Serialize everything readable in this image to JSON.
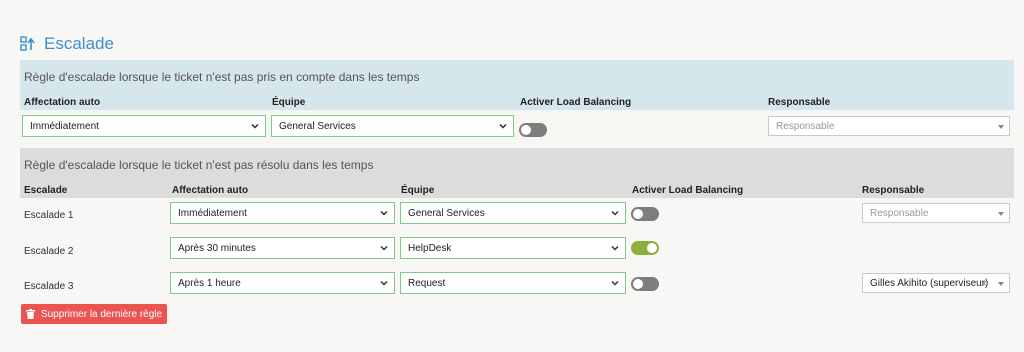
{
  "page": {
    "title": "Escalade"
  },
  "section1": {
    "subtitle": "Règle d'escalade lorsque le ticket n'est pas pris en compte dans les temps",
    "headers": {
      "affectation": "Affectation auto",
      "equipe": "Équipe",
      "load_balancing": "Activer Load Balancing",
      "responsable": "Responsable"
    },
    "row": {
      "affectation": "Immédiatement",
      "equipe": "General Services",
      "load_balancing_on": false,
      "responsable_placeholder": "Responsable"
    }
  },
  "section2": {
    "subtitle": "Règle d'escalade lorsque le ticket n'est pas résolu dans les temps",
    "headers": {
      "escalade": "Escalade",
      "affectation": "Affectation auto",
      "equipe": "Équipe",
      "load_balancing": "Activer Load Balancing",
      "responsable": "Responsable"
    },
    "rows": [
      {
        "label": "Escalade 1",
        "affectation": "Immédiatement",
        "equipe": "General Services",
        "load_balancing_on": false,
        "responsable": "Responsable"
      },
      {
        "label": "Escalade 2",
        "affectation": "Après 30 minutes",
        "equipe": "HelpDesk",
        "load_balancing_on": true,
        "responsable": ""
      },
      {
        "label": "Escalade 3",
        "affectation": "Après 1 heure",
        "equipe": "Request",
        "load_balancing_on": false,
        "responsable": "Gilles Akihito (superviseur)",
        "responsable_clear": "×"
      }
    ]
  },
  "actions": {
    "delete_last_rule": "Supprimer la dernière règle"
  },
  "colors": {
    "accent": "#3b8fd0",
    "toggle_on": "#8ab23a",
    "danger": "#ea5451",
    "select_border": "#7fc98a"
  },
  "icons": {
    "title": "escalation-icon",
    "dropdown": "chevron-down-icon",
    "delete": "trash-icon"
  }
}
